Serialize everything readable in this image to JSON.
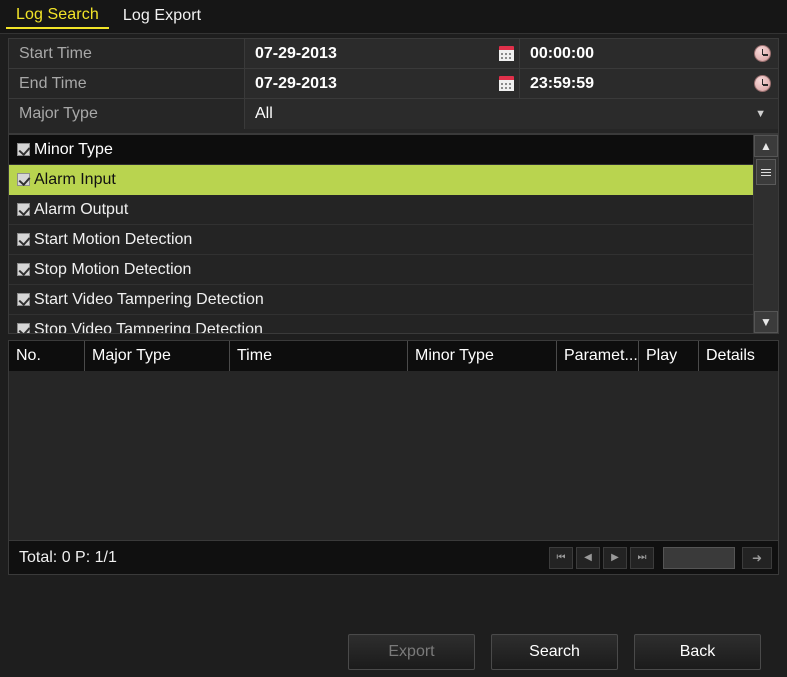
{
  "tabs": [
    {
      "label": "Log Search",
      "active": true
    },
    {
      "label": "Log Export",
      "active": false
    }
  ],
  "form": {
    "start_time": {
      "label": "Start Time",
      "date": "07-29-2013",
      "time": "00:00:00",
      "calendar_icon": "calendar-icon",
      "clock_icon": "clock-icon"
    },
    "end_time": {
      "label": "End Time",
      "date": "07-29-2013",
      "time": "23:59:59",
      "calendar_icon": "calendar-icon",
      "clock_icon": "clock-icon"
    },
    "major_type": {
      "label": "Major Type",
      "value": "All",
      "chevron_icon": "chevron-down-icon"
    }
  },
  "minor_type_list": {
    "header": {
      "label": "Minor Type",
      "checked": true
    },
    "items": [
      {
        "label": "Alarm Input",
        "checked": true,
        "selected": true
      },
      {
        "label": "Alarm Output",
        "checked": true,
        "selected": false
      },
      {
        "label": "Start Motion Detection",
        "checked": true,
        "selected": false
      },
      {
        "label": "Stop Motion Detection",
        "checked": true,
        "selected": false
      },
      {
        "label": "Start Video Tampering Detection",
        "checked": true,
        "selected": false
      },
      {
        "label": "Stop Video Tampering Detection",
        "checked": true,
        "selected": false
      }
    ],
    "scrollbar": {
      "up_icon": "chevron-up-icon",
      "down_icon": "chevron-down-icon",
      "thumb_icon": "scroll-thumb-grip"
    }
  },
  "results_table": {
    "columns": [
      "No.",
      "Major Type",
      "Time",
      "Minor Type",
      "Paramet...",
      "Play",
      "Details"
    ],
    "rows": [],
    "footer": {
      "total_text": "Total: 0  P: 1/1",
      "first_icon": "first-page-icon",
      "prev_icon": "prev-page-icon",
      "next_icon": "next-page-icon",
      "last_icon": "last-page-icon",
      "page_input_value": "",
      "go_icon": "go-arrow-icon"
    }
  },
  "buttons": {
    "export": {
      "label": "Export",
      "disabled": true
    },
    "search": {
      "label": "Search",
      "disabled": false
    },
    "back": {
      "label": "Back",
      "disabled": false
    }
  },
  "colors": {
    "accent_tab": "#f2e428",
    "selection": "#b9d44f",
    "panel_bg": "#262626",
    "header_bg": "#0d0d0d",
    "calendar_red": "#e0304a"
  }
}
